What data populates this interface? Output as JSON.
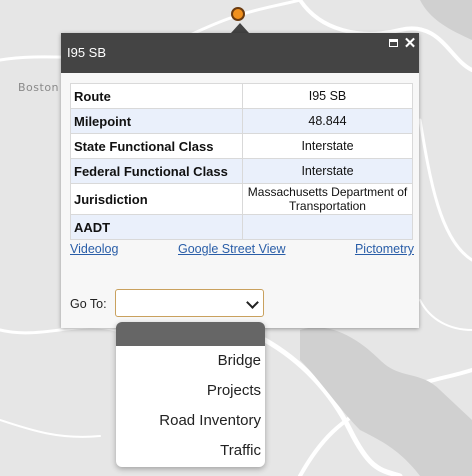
{
  "map": {
    "place_label": "Boston"
  },
  "popup": {
    "title": "I95 SB",
    "rows": [
      {
        "key": "Route",
        "value": "I95 SB"
      },
      {
        "key": "Milepoint",
        "value": "48.844"
      },
      {
        "key": "State Functional Class",
        "value": "Interstate"
      },
      {
        "key": "Federal Functional Class",
        "value": "Interstate"
      },
      {
        "key": "Jurisdiction",
        "value": "Massachusetts Department of Transportation"
      },
      {
        "key": "AADT",
        "value": ""
      }
    ],
    "links": {
      "videolog": "Videolog",
      "street_view": "Google Street View",
      "pictometry": "Pictometry"
    },
    "goto_label": "Go To:",
    "goto_value": ""
  },
  "dropdown": {
    "options": [
      "",
      "Bridge",
      "Projects",
      "Road Inventory",
      "Traffic"
    ]
  },
  "colors": {
    "header": "#444444",
    "marker": "#f0901e",
    "link": "#2a5ea8",
    "select_border": "#c9a15e"
  }
}
